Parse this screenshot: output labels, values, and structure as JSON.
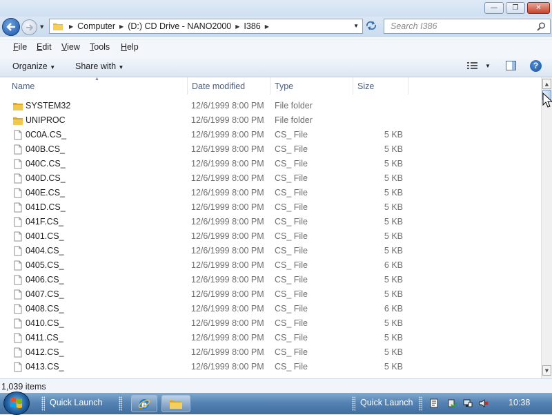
{
  "window": {
    "minimize_glyph": "—",
    "maximize_glyph": "❐",
    "close_glyph": "✕"
  },
  "address": {
    "breadcrumbs": [
      "Computer",
      "(D:) CD Drive - NANO2000",
      "I386"
    ]
  },
  "search": {
    "placeholder": "Search I386"
  },
  "menu": {
    "file": {
      "u": "F",
      "rest": "ile"
    },
    "edit": {
      "u": "E",
      "rest": "dit"
    },
    "view": {
      "u": "V",
      "rest": "iew"
    },
    "tools": {
      "u": "T",
      "rest": "ools"
    },
    "help": {
      "u": "H",
      "rest": "elp"
    }
  },
  "toolbar": {
    "organize": "Organize",
    "share_with": "Share with"
  },
  "columns": {
    "name": "Name",
    "date": "Date modified",
    "type": "Type",
    "size": "Size"
  },
  "files": [
    {
      "name": "SYSTEM32",
      "date": "12/6/1999 8:00 PM",
      "type": "File folder",
      "size": "",
      "icon": "folder-icon"
    },
    {
      "name": "UNIPROC",
      "date": "12/6/1999 8:00 PM",
      "type": "File folder",
      "size": "",
      "icon": "folder-icon"
    },
    {
      "name": "0C0A.CS_",
      "date": "12/6/1999 8:00 PM",
      "type": "CS_ File",
      "size": "5 KB",
      "icon": "file-icon"
    },
    {
      "name": "040B.CS_",
      "date": "12/6/1999 8:00 PM",
      "type": "CS_ File",
      "size": "5 KB",
      "icon": "file-icon"
    },
    {
      "name": "040C.CS_",
      "date": "12/6/1999 8:00 PM",
      "type": "CS_ File",
      "size": "5 KB",
      "icon": "file-icon"
    },
    {
      "name": "040D.CS_",
      "date": "12/6/1999 8:00 PM",
      "type": "CS_ File",
      "size": "5 KB",
      "icon": "file-icon"
    },
    {
      "name": "040E.CS_",
      "date": "12/6/1999 8:00 PM",
      "type": "CS_ File",
      "size": "5 KB",
      "icon": "file-icon"
    },
    {
      "name": "041D.CS_",
      "date": "12/6/1999 8:00 PM",
      "type": "CS_ File",
      "size": "5 KB",
      "icon": "file-icon"
    },
    {
      "name": "041F.CS_",
      "date": "12/6/1999 8:00 PM",
      "type": "CS_ File",
      "size": "5 KB",
      "icon": "file-icon"
    },
    {
      "name": "0401.CS_",
      "date": "12/6/1999 8:00 PM",
      "type": "CS_ File",
      "size": "5 KB",
      "icon": "file-icon"
    },
    {
      "name": "0404.CS_",
      "date": "12/6/1999 8:00 PM",
      "type": "CS_ File",
      "size": "5 KB",
      "icon": "file-icon"
    },
    {
      "name": "0405.CS_",
      "date": "12/6/1999 8:00 PM",
      "type": "CS_ File",
      "size": "6 KB",
      "icon": "file-icon"
    },
    {
      "name": "0406.CS_",
      "date": "12/6/1999 8:00 PM",
      "type": "CS_ File",
      "size": "5 KB",
      "icon": "file-icon"
    },
    {
      "name": "0407.CS_",
      "date": "12/6/1999 8:00 PM",
      "type": "CS_ File",
      "size": "5 KB",
      "icon": "file-icon"
    },
    {
      "name": "0408.CS_",
      "date": "12/6/1999 8:00 PM",
      "type": "CS_ File",
      "size": "6 KB",
      "icon": "file-icon"
    },
    {
      "name": "0410.CS_",
      "date": "12/6/1999 8:00 PM",
      "type": "CS_ File",
      "size": "5 KB",
      "icon": "file-icon"
    },
    {
      "name": "0411.CS_",
      "date": "12/6/1999 8:00 PM",
      "type": "CS_ File",
      "size": "5 KB",
      "icon": "file-icon"
    },
    {
      "name": "0412.CS_",
      "date": "12/6/1999 8:00 PM",
      "type": "CS_ File",
      "size": "5 KB",
      "icon": "file-icon"
    },
    {
      "name": "0413.CS_",
      "date": "12/6/1999 8:00 PM",
      "type": "CS_ File",
      "size": "5 KB",
      "icon": "file-icon"
    }
  ],
  "status": {
    "item_count": "1,039 items"
  },
  "taskbar": {
    "quick_launch_left": "Quick Launch",
    "quick_launch_right": "Quick Launch",
    "clock": "10:38"
  },
  "colors": {
    "accent": "#3f6d9e",
    "folder": "#e8b936",
    "header_text": "#4c607a",
    "secondary_text": "#6d6d6d"
  }
}
